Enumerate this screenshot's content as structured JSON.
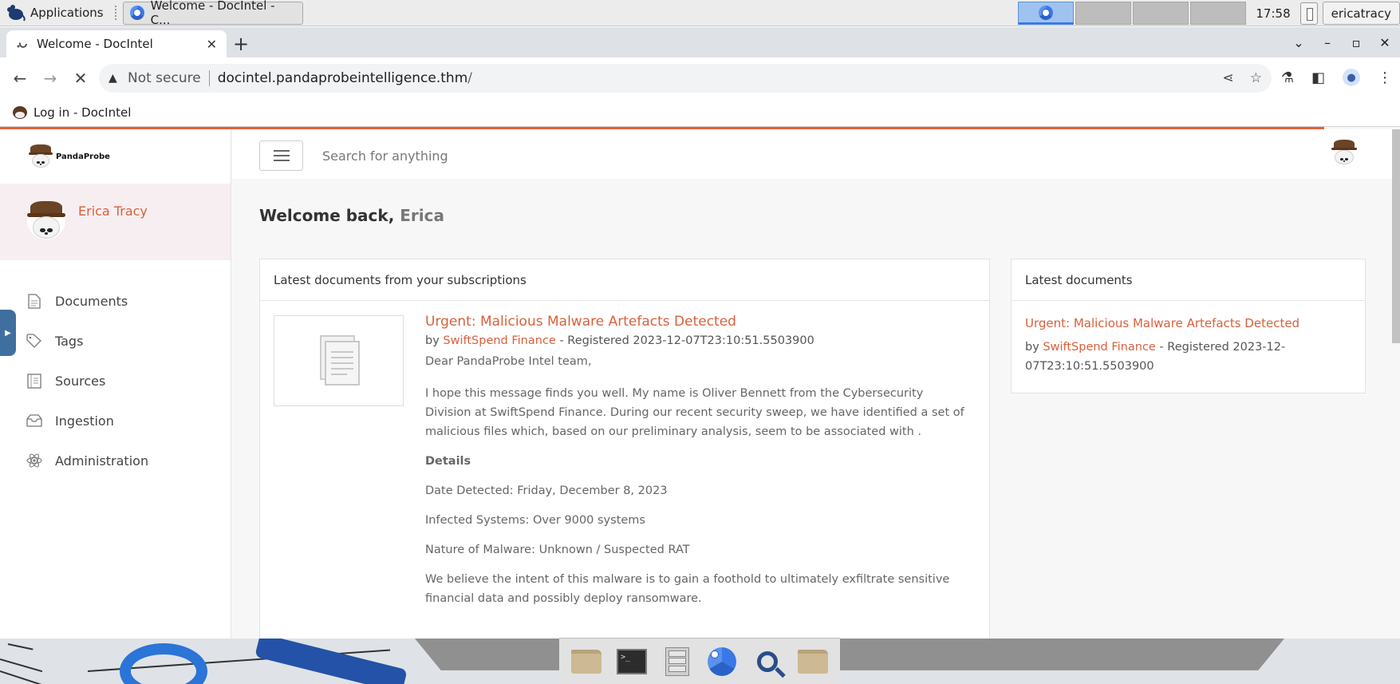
{
  "os": {
    "apps_label": "Applications",
    "task_title": "Welcome - DocIntel - C...",
    "clock": "17:58",
    "user": "ericatracy"
  },
  "browser": {
    "tab_title": "Welcome - DocIntel",
    "new_tab": "+",
    "not_secure": "Not secure",
    "url_host": "docintel.pandaprobeintelligence.thm",
    "url_path": "/",
    "bookmark": "Log in - DocIntel"
  },
  "sidebar": {
    "brand": "PandaProbe",
    "user_name": "Erica Tracy",
    "items": [
      {
        "label": "Documents",
        "icon": "document-icon"
      },
      {
        "label": "Tags",
        "icon": "tag-icon"
      },
      {
        "label": "Sources",
        "icon": "sources-icon"
      },
      {
        "label": "Ingestion",
        "icon": "inbox-icon"
      },
      {
        "label": "Administration",
        "icon": "atom-icon"
      }
    ]
  },
  "topbar": {
    "search_placeholder": "Search for anything"
  },
  "welcome": {
    "prefix": "Welcome back,",
    "name": "Erica"
  },
  "subscriptions": {
    "header": "Latest documents from your subscriptions",
    "doc": {
      "title": "Urgent: Malicious Malware Artefacts Detected",
      "by": "by",
      "source": "SwiftSpend Finance",
      "registered": "-  Registered 2023-12-07T23:10:51.5503900",
      "greeting": "Dear PandaProbe Intel team,",
      "intro": "I hope this message finds you well. My name is Oliver Bennett from the Cybersecurity Division at SwiftSpend Finance. During our recent security sweep, we have identified a set of malicious files which, based on our preliminary analysis, seem to be associated with .",
      "details_heading": "Details",
      "date_detected": "Date Detected: Friday, December 8, 2023",
      "infected": "Infected Systems: Over 9000 systems",
      "nature": "Nature of Malware: Unknown / Suspected RAT",
      "intent": "We believe the intent of this malware is to gain a foothold to ultimately exfiltrate sensitive financial data and possibly deploy ransomware."
    }
  },
  "latest": {
    "header": "Latest documents",
    "title": "Urgent: Malicious Malware Artefacts Detected",
    "by": "by",
    "source": "SwiftSpend Finance",
    "registered": "-  Registered 2023-12-07T23:10:51.5503900"
  }
}
